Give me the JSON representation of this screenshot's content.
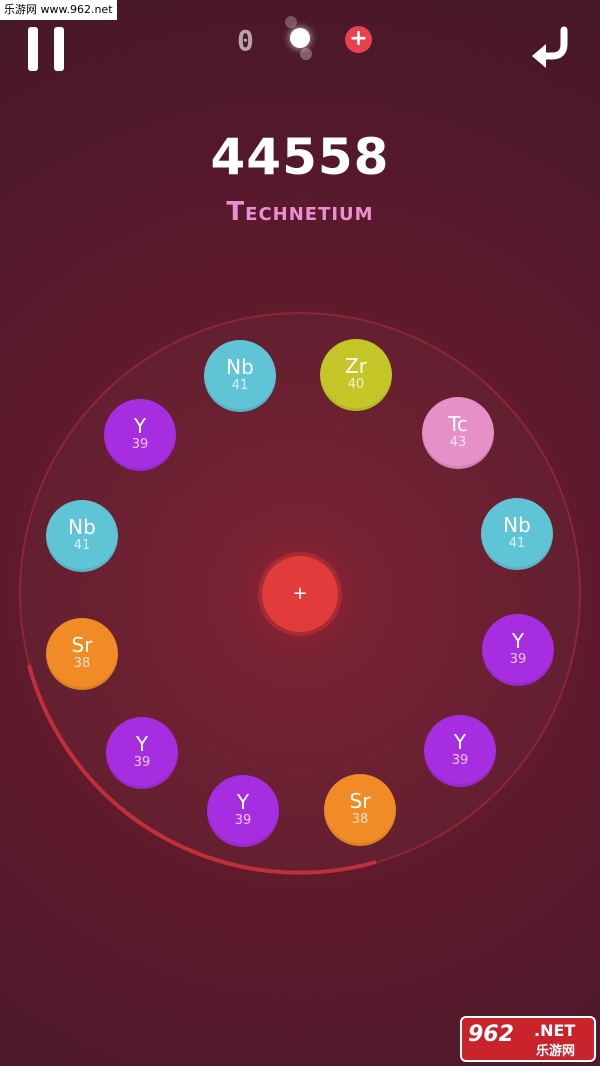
{
  "watermark": {
    "top_text": "乐游网 www.962.net"
  },
  "hud": {
    "counter": "0",
    "plus_label": "+"
  },
  "score": "44558",
  "element_name": "Technetium",
  "center_atom": {
    "label": "+",
    "color": "#e13b3c"
  },
  "atoms": [
    {
      "symbol": "Nb",
      "number": "41",
      "color": "#5fc4d6"
    },
    {
      "symbol": "Zr",
      "number": "40",
      "color": "#c4c627"
    },
    {
      "symbol": "Tc",
      "number": "43",
      "color": "#e590c6"
    },
    {
      "symbol": "Nb",
      "number": "41",
      "color": "#5fc4d6"
    },
    {
      "symbol": "Y",
      "number": "39",
      "color": "#a72ee0"
    },
    {
      "symbol": "Y",
      "number": "39",
      "color": "#a72ee0"
    },
    {
      "symbol": "Sr",
      "number": "38",
      "color": "#f08b25"
    },
    {
      "symbol": "Y",
      "number": "39",
      "color": "#a72ee0"
    },
    {
      "symbol": "Y",
      "number": "39",
      "color": "#a72ee0"
    },
    {
      "symbol": "Sr",
      "number": "38",
      "color": "#f08b25"
    },
    {
      "symbol": "Nb",
      "number": "41",
      "color": "#5fc4d6"
    },
    {
      "symbol": "Y",
      "number": "39",
      "color": "#a72ee0"
    }
  ],
  "logo": {
    "number": "962",
    "net": ".NET",
    "cn": "乐游网"
  },
  "colors": {
    "background": "#5e1a2c",
    "score": "#ffffff",
    "element_name": "#ec8fd2",
    "ring": "#c0303a"
  }
}
